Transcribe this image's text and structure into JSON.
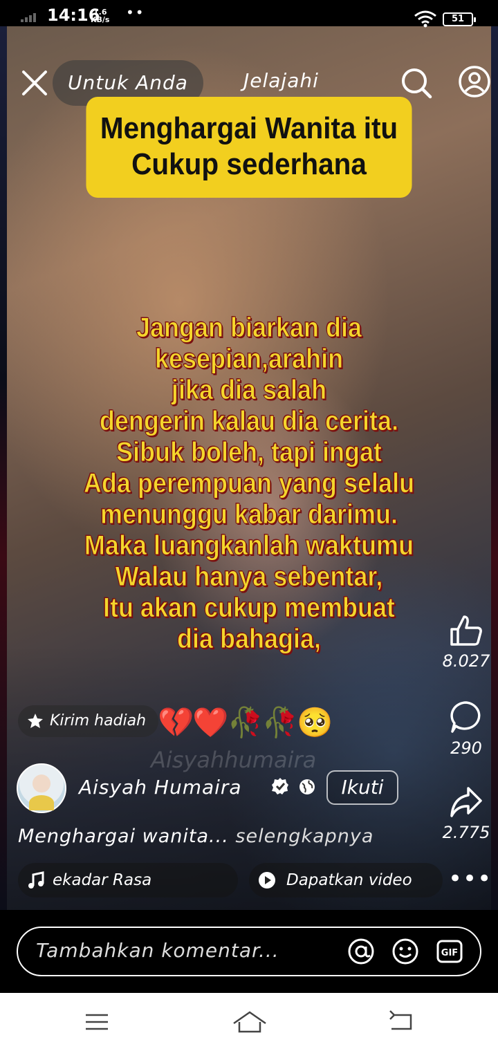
{
  "status_bar": {
    "time": "14:16",
    "net_speed_value": "1.6",
    "net_speed_unit": "KB/s",
    "dots": "••",
    "battery": "51"
  },
  "top_nav": {
    "tab_for_you": "Untuk Anda",
    "tab_explore": "Jelajahi"
  },
  "video": {
    "title_line1": "Menghargai Wanita itu",
    "title_line2": "Cukup sederhana",
    "caption_lines": [
      "Jangan biarkan dia",
      "kesepian,arahin",
      "jika dia salah",
      "dengerin kalau dia cerita.",
      "Sibuk boleh, tapi ingat",
      "Ada perempuan yang selalu",
      "menunggu kabar darimu.",
      "Maka luangkanlah waktumu",
      "Walau hanya sebentar,",
      "Itu akan cukup membuat",
      "dia bahagia,"
    ],
    "watermark": "Aisyahhumaira"
  },
  "actions": {
    "likes": "8.027",
    "comments": "290",
    "shares": "2.775"
  },
  "gift": {
    "label": "Kirim hadiah",
    "emojis": "💔❤️🥀🥀🥺"
  },
  "author": {
    "name": "Aisyah Humaira",
    "follow_label": "Ikuti"
  },
  "description": {
    "text": "Menghargai wanita...",
    "more": "selengkapnya"
  },
  "chips": {
    "music": "ekadar Rasa",
    "video": "Dapatkan video"
  },
  "comment": {
    "placeholder": "Tambahkan komentar..."
  },
  "colors": {
    "title_card": "#f2cf1f",
    "caption_text": "#f4d62c",
    "caption_outline": "#7a1010"
  },
  "icons": [
    "close-icon",
    "search-icon",
    "profile-icon",
    "like-icon",
    "comment-icon",
    "share-icon",
    "gift-icon",
    "verified-icon",
    "globe-icon",
    "music-icon",
    "play-icon",
    "more-icon",
    "mention-icon",
    "emoji-icon",
    "gif-icon",
    "menu-icon",
    "home-icon",
    "back-icon"
  ]
}
